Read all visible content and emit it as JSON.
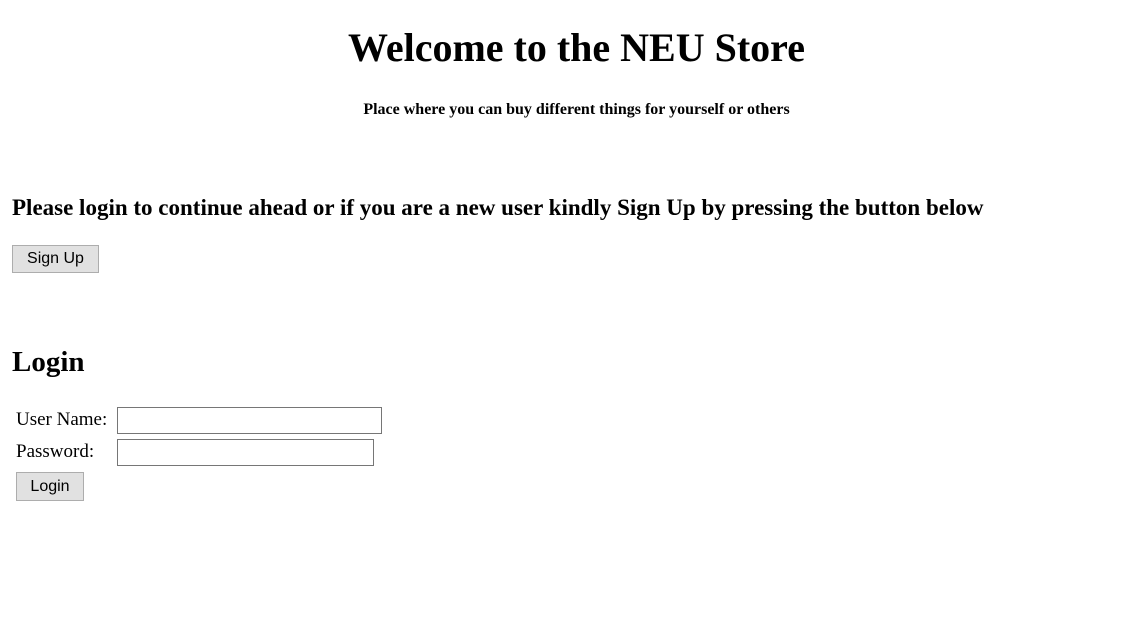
{
  "header": {
    "title": "Welcome to the NEU Store",
    "tagline": "Place where you can buy different things for yourself or others"
  },
  "signup_section": {
    "instructions": "Please login to continue ahead or if you are a new user kindly Sign Up by pressing the button below",
    "signup_button_label": "Sign Up"
  },
  "login_form": {
    "heading": "Login",
    "username_label": "User Name:",
    "username_value": "",
    "username_placeholder": "",
    "password_label": "Password:",
    "password_value": "",
    "password_placeholder": "",
    "login_button_label": "Login"
  }
}
